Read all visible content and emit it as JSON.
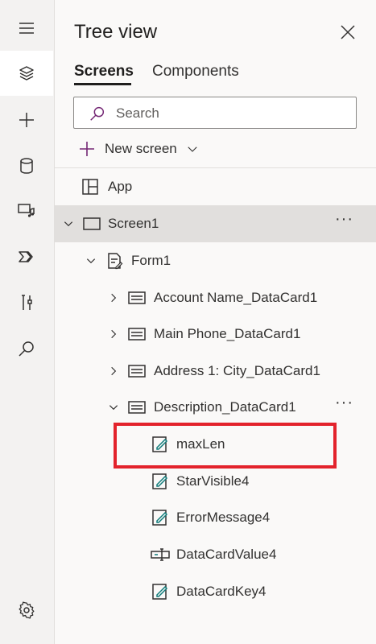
{
  "panel": {
    "title": "Tree view",
    "tabs": [
      {
        "label": "Screens",
        "active": true
      },
      {
        "label": "Components",
        "active": false
      }
    ],
    "search": {
      "placeholder": "Search",
      "value": ""
    },
    "new_screen_label": "New screen"
  },
  "rail": {
    "items": [
      {
        "name": "hamburger-menu-icon"
      },
      {
        "name": "layers-icon",
        "active": true
      },
      {
        "name": "add-icon"
      },
      {
        "name": "database-icon"
      },
      {
        "name": "media-icon"
      },
      {
        "name": "power-automate-icon"
      },
      {
        "name": "tools-icon"
      },
      {
        "name": "search-icon"
      },
      {
        "name": "settings-icon"
      }
    ]
  },
  "tree": [
    {
      "label": "App",
      "icon": "app-icon",
      "expandable": false
    },
    {
      "label": "Screen1",
      "icon": "screen-icon",
      "expanded": true,
      "selected": true,
      "more": "···"
    },
    {
      "label": "Form1",
      "icon": "form-icon",
      "expanded": true
    },
    {
      "label": "Account Name_DataCard1",
      "icon": "datacard-icon",
      "expanded": false
    },
    {
      "label": "Main Phone_DataCard1",
      "icon": "datacard-icon",
      "expanded": false
    },
    {
      "label": "Address 1: City_DataCard1",
      "icon": "datacard-icon",
      "expanded": false
    },
    {
      "label": "Description_DataCard1",
      "icon": "datacard-icon",
      "expanded": true,
      "more": "···"
    },
    {
      "label": "maxLen",
      "icon": "label-edit-icon",
      "highlighted": true
    },
    {
      "label": "StarVisible4",
      "icon": "label-edit-icon"
    },
    {
      "label": "ErrorMessage4",
      "icon": "label-edit-icon"
    },
    {
      "label": "DataCardValue4",
      "icon": "text-input-icon"
    },
    {
      "label": "DataCardKey4",
      "icon": "label-edit-icon"
    }
  ],
  "colors": {
    "accent": "#742774",
    "highlight_border": "#e3232c",
    "selected_row": "#e1dfdd"
  }
}
